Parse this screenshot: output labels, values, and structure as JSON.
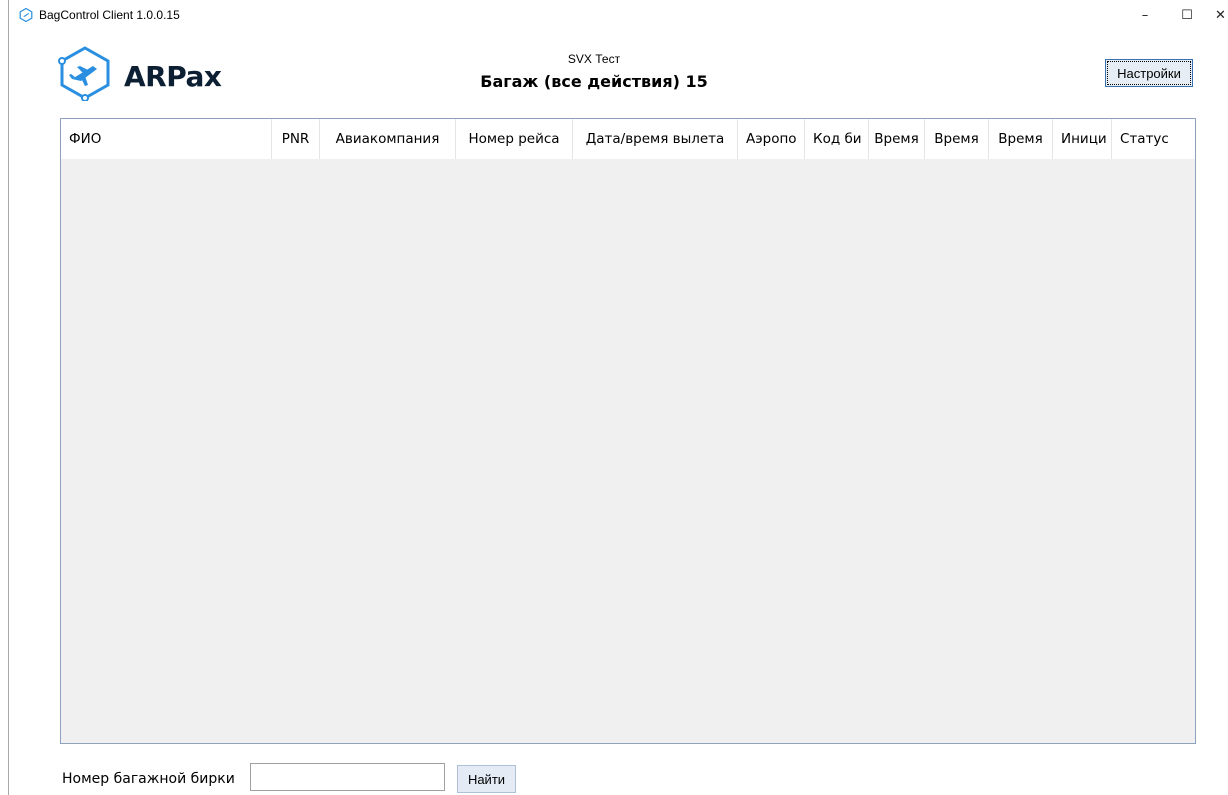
{
  "window": {
    "title": "BagControl Client 1.0.0.15",
    "minimize_glyph": "–",
    "maximize_glyph": "☐",
    "close_glyph": "✕"
  },
  "header": {
    "logo_text": "ARPax",
    "logo_icon": "airplane-hexagon-icon",
    "subtitle": "SVX Тест",
    "title": "Багаж (все действия) 15",
    "settings_label": "Настройки"
  },
  "grid": {
    "columns": [
      "ФИО",
      "PNR",
      "Авиакомпания",
      "Номер рейса",
      "Дата/время вылета",
      "Аэропо",
      "Код би",
      "Время",
      "Время",
      "Время",
      "Иници",
      "Статус"
    ],
    "rows": []
  },
  "search": {
    "label": "Номер багажной бирки",
    "value": "",
    "button_label": "Найти"
  },
  "colors": {
    "brand_blue": "#2a8fe0",
    "logo_dark": "#0c1f33",
    "grid_background": "#f0f0f0",
    "grid_border": "#8ea2bd"
  }
}
